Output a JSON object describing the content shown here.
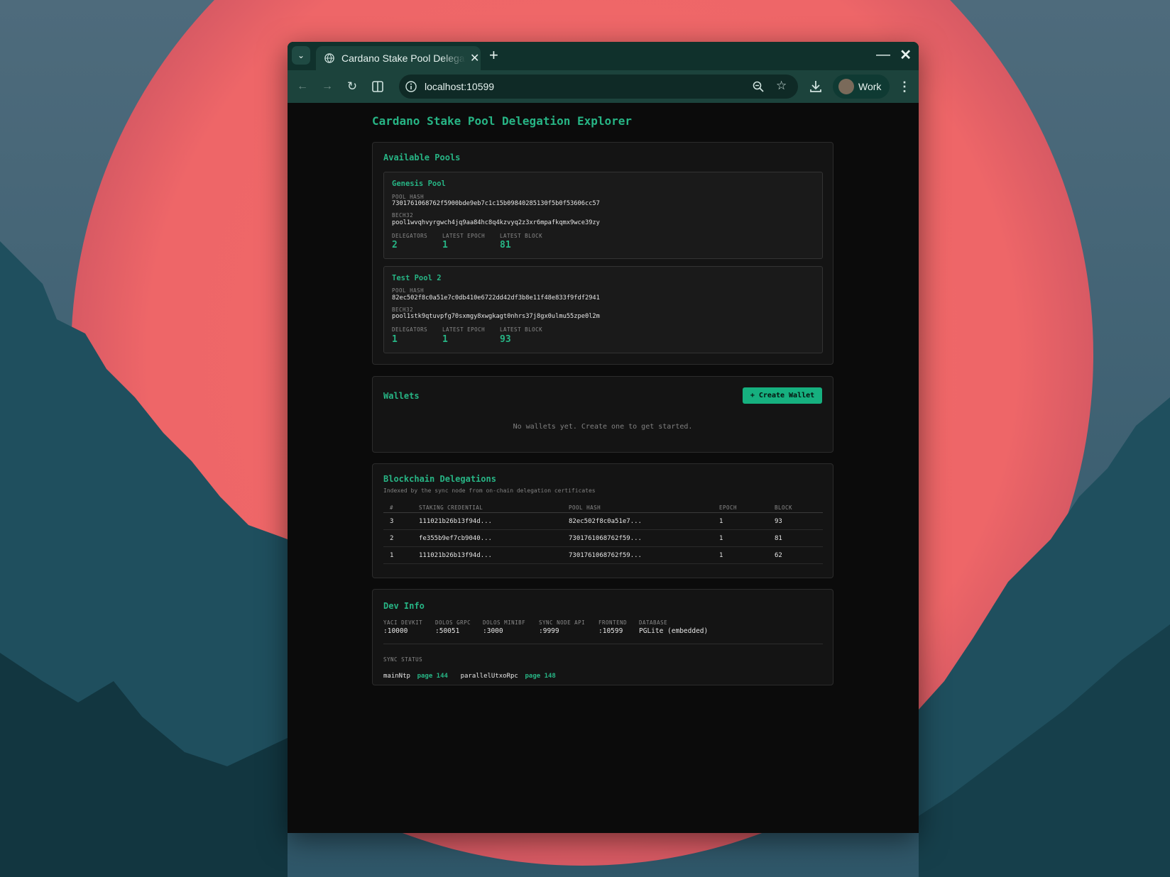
{
  "browser": {
    "tab_title": "Cardano Stake Pool Delegation Explorer",
    "url": "localhost:10599",
    "profile_name": "Work"
  },
  "page": {
    "title": "Cardano Stake Pool Delegation Explorer"
  },
  "pools": {
    "title": "Available Pools",
    "labels": {
      "pool_hash": "POOL HASH",
      "bech32": "BECH32",
      "delegators": "DELEGATORS",
      "latest_epoch": "LATEST EPOCH",
      "latest_block": "LATEST BLOCK"
    },
    "items": [
      {
        "name": "Genesis Pool",
        "pool_hash": "7301761068762f5900bde9eb7c1c15b09840285130f5b0f53606cc57",
        "bech32": "pool1wvqhvyrgwch4jq9aa84hc8q4kzvyq2z3xr6mpafkqmx9wce39zy",
        "delegators": "2",
        "latest_epoch": "1",
        "latest_block": "81"
      },
      {
        "name": "Test Pool 2",
        "pool_hash": "82ec502f8c0a51e7c0db410e6722dd42df3b8e11f48e833f9fdf2941",
        "bech32": "pool1stk9qtuvpfg70sxmgy8xwgkagt0nhrs37j8gx0ulmu55zpe0l2m",
        "delegators": "1",
        "latest_epoch": "1",
        "latest_block": "93"
      }
    ]
  },
  "wallets": {
    "title": "Wallets",
    "create_label": "+ Create Wallet",
    "empty_message": "No wallets yet. Create one to get started."
  },
  "delegations": {
    "title": "Blockchain Delegations",
    "subtitle": "Indexed by the sync node from on-chain delegation certificates",
    "columns": [
      "#",
      "STAKING CREDENTIAL",
      "POOL HASH",
      "EPOCH",
      "BLOCK"
    ],
    "rows": [
      [
        "3",
        "111021b26b13f94d...",
        "82ec502f8c0a51e7...",
        "1",
        "93"
      ],
      [
        "2",
        "fe355b9ef7cb9040...",
        "7301761068762f59...",
        "1",
        "81"
      ],
      [
        "1",
        "111021b26b13f94d...",
        "7301761068762f59...",
        "1",
        "62"
      ]
    ]
  },
  "dev_info": {
    "title": "Dev Info",
    "services": [
      {
        "label": "YACI DEVKIT",
        "value": ":10000"
      },
      {
        "label": "DOLOS GRPC",
        "value": ":50051"
      },
      {
        "label": "DOLOS MINIBF",
        "value": ":3000"
      },
      {
        "label": "SYNC NODE API",
        "value": ":9999"
      },
      {
        "label": "FRONTEND",
        "value": ":10599"
      },
      {
        "label": "DATABASE",
        "value": "PGLite (embedded)"
      }
    ],
    "sync_label": "SYNC STATUS",
    "sync": [
      {
        "name": "mainNtp",
        "value": "page 144"
      },
      {
        "name": "parallelUtxoRpc",
        "value": "page 148"
      }
    ]
  },
  "colors": {
    "accent": "#27b585",
    "button": "#16b07f",
    "page_bg": "#0b0b0b",
    "panel_bg": "#141414",
    "titlebar": "#10312c"
  }
}
